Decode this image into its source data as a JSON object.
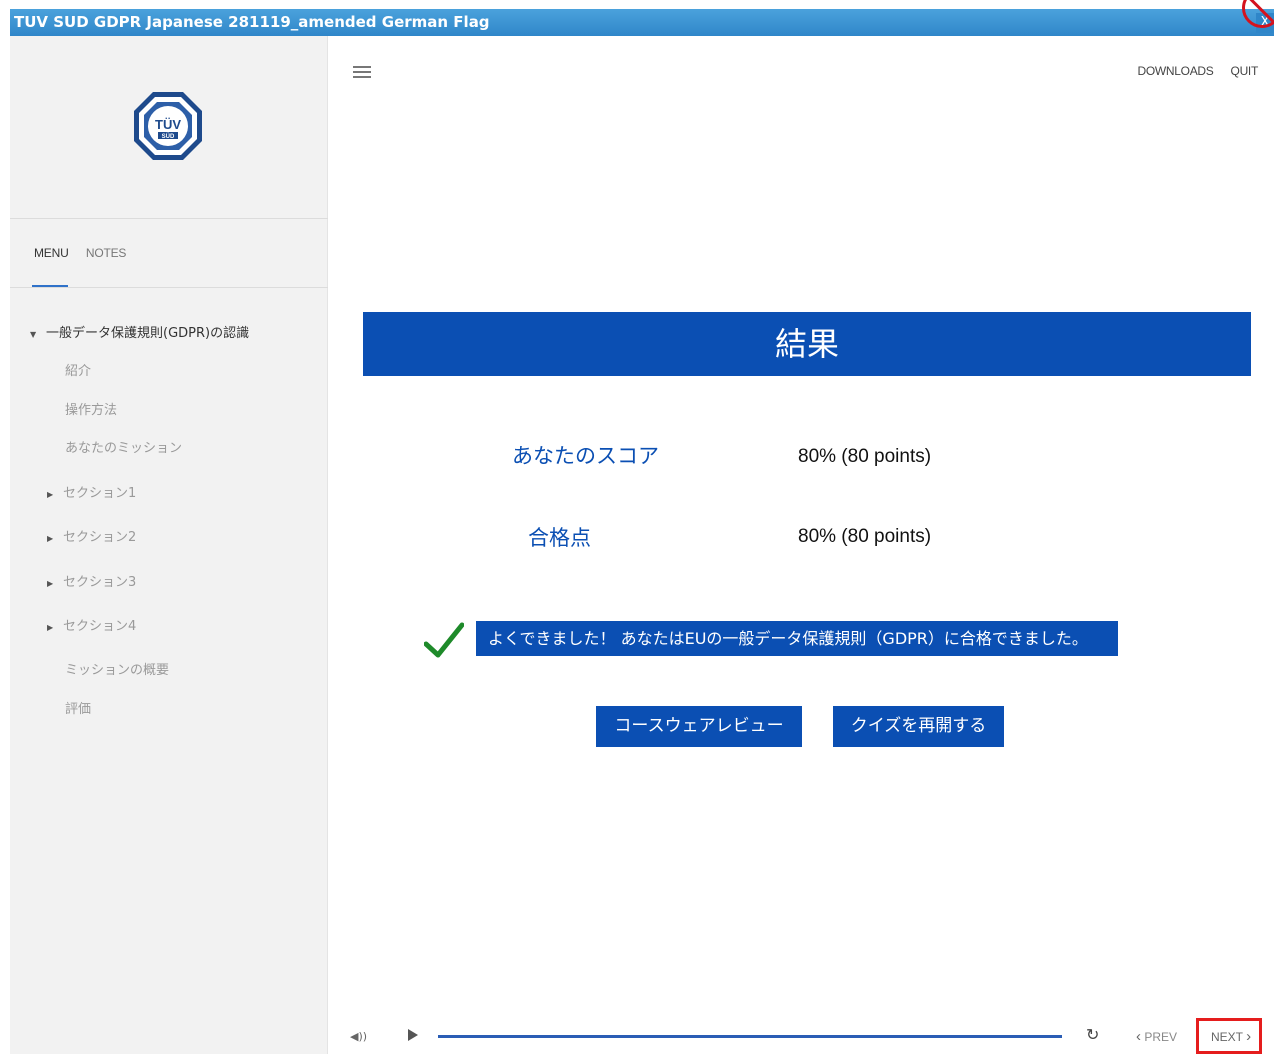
{
  "window": {
    "title": "TUV SUD GDPR Japanese 281119_amended German Flag",
    "close_glyph": "X"
  },
  "logo": {
    "line1": "TÜV",
    "line2": "SÜD"
  },
  "sidebar": {
    "tabs": [
      {
        "label": "MENU",
        "active": true
      },
      {
        "label": "NOTES",
        "active": false
      }
    ],
    "tree": [
      {
        "label": "一般データ保護規則(GDPR)の認識",
        "level": 0,
        "expanded": true
      },
      {
        "label": "紹介",
        "level": 1
      },
      {
        "label": "操作方法",
        "level": 1
      },
      {
        "label": "あなたのミッション",
        "level": 1
      },
      {
        "label": "セクション1",
        "level": 1,
        "collapsed": true
      },
      {
        "label": "セクション2",
        "level": 1,
        "collapsed": true
      },
      {
        "label": "セクション3",
        "level": 1,
        "collapsed": true
      },
      {
        "label": "セクション4",
        "level": 1,
        "collapsed": true
      },
      {
        "label": "ミッションの概要",
        "level": 1
      },
      {
        "label": "評価",
        "level": 1
      }
    ]
  },
  "topbar": {
    "downloads": "DOWNLOADS",
    "quit": "QUIT"
  },
  "result": {
    "heading": "結果",
    "score_label": "あなたのスコア",
    "score_value": "80% (80 points)",
    "pass_label": "合格点",
    "pass_value": "80% (80 points)",
    "message": "よくできました！ あなたはEUの一般データ保護規則（GDPR）に合格できました。",
    "review_button": "コースウェアレビュー",
    "retry_button": "クイズを再開する"
  },
  "player": {
    "prev": "PREV",
    "next": "NEXT",
    "progress_fraction": 1.0
  },
  "colors": {
    "accent": "#0b4fb3",
    "titlebar": "#2f86c9",
    "highlight": "#e51d1d"
  }
}
